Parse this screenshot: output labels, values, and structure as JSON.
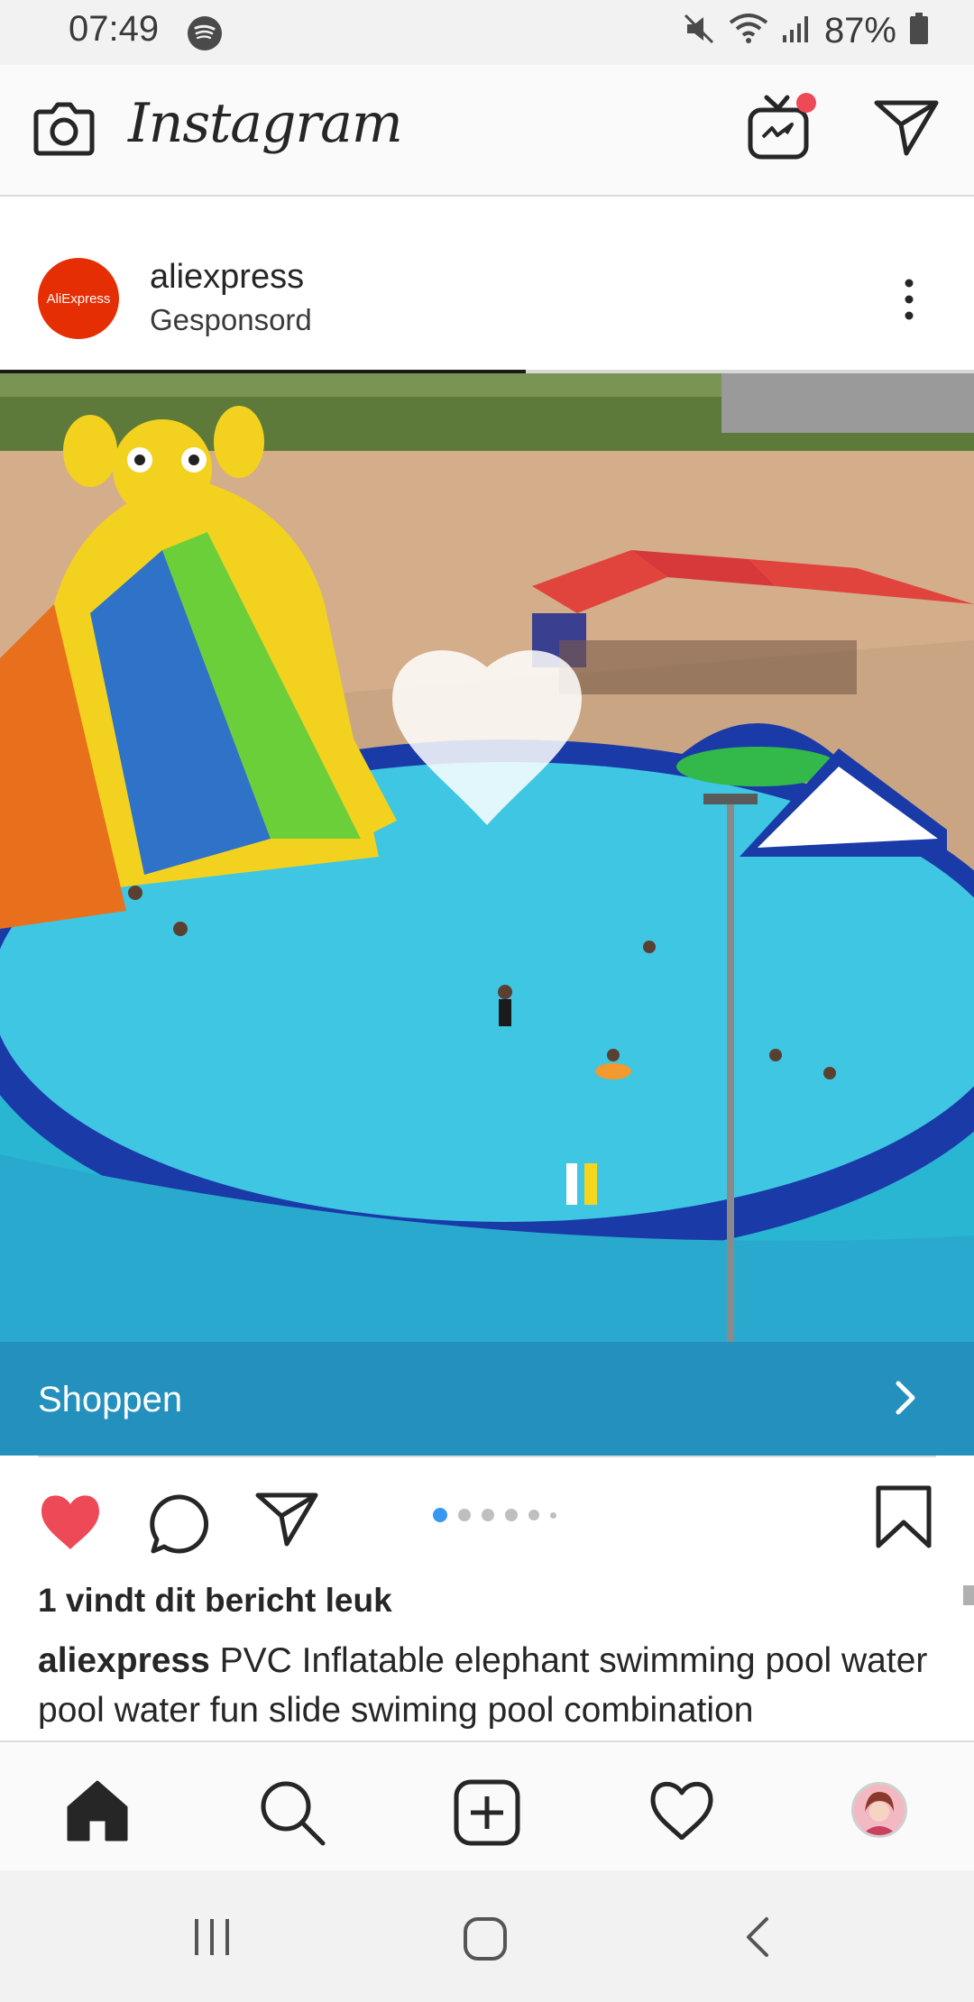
{
  "status_bar": {
    "time": "07:49",
    "battery": "87%",
    "icons": [
      "spotify-icon",
      "mute-icon",
      "wifi-icon",
      "signal-icon",
      "battery-icon"
    ]
  },
  "top_bar": {
    "logo": "Instagram",
    "icons": [
      "camera-icon",
      "igtv-icon",
      "direct-message-icon"
    ],
    "notification_color": "#ed4956"
  },
  "post": {
    "avatar_text": "AliExpress",
    "username": "aliexpress",
    "sponsored_label": "Gesponsord",
    "carousel_progress": 0.54,
    "image_subject": "inflatable elephant water slide pool",
    "shop_label": "Shoppen",
    "shop_color": "#2390bd",
    "carousel_dots": 6,
    "carousel_active": 0,
    "likes_text": "1 vindt dit bericht leuk",
    "caption_user": "aliexpress",
    "caption_text": " PVC Inflatable elephant swimming pool water pool water fun slide swiming pool combination",
    "liked": true,
    "like_color": "#ed4956",
    "accent_color": "#3897f0"
  },
  "bottom_nav": {
    "items": [
      "home-icon",
      "search-icon",
      "new-post-icon",
      "activity-icon",
      "profile-avatar"
    ]
  },
  "system_nav": {
    "items": [
      "recent-apps-icon",
      "home-button-icon",
      "back-icon"
    ]
  }
}
